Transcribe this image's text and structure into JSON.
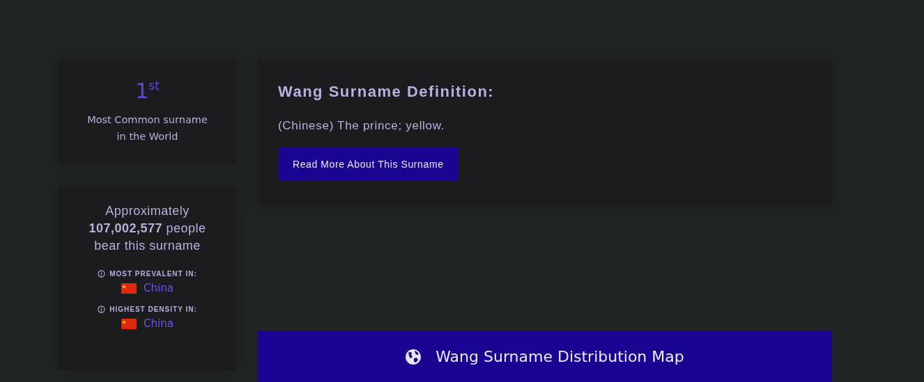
{
  "rank_card": {
    "rank": "1$^{st}$",
    "caption": "Most Common surname in the World"
  },
  "count_card": {
    "sentence": "Approximately **107,002,577** people bear this surname",
    "facts": [
      {
        "label": "MOST PREVALENT IN:",
        "country": "China"
      },
      {
        "label": "HIGHEST DENSITY IN:",
        "country": "China"
      }
    ]
  },
  "definition_card": {
    "title": "Wang Surname Definition:",
    "text": "(Chinese) The prince; yellow.",
    "button": "Read More About This Surname"
  },
  "map_button": {
    "label": "Wang Surname Distribution Map"
  }
}
